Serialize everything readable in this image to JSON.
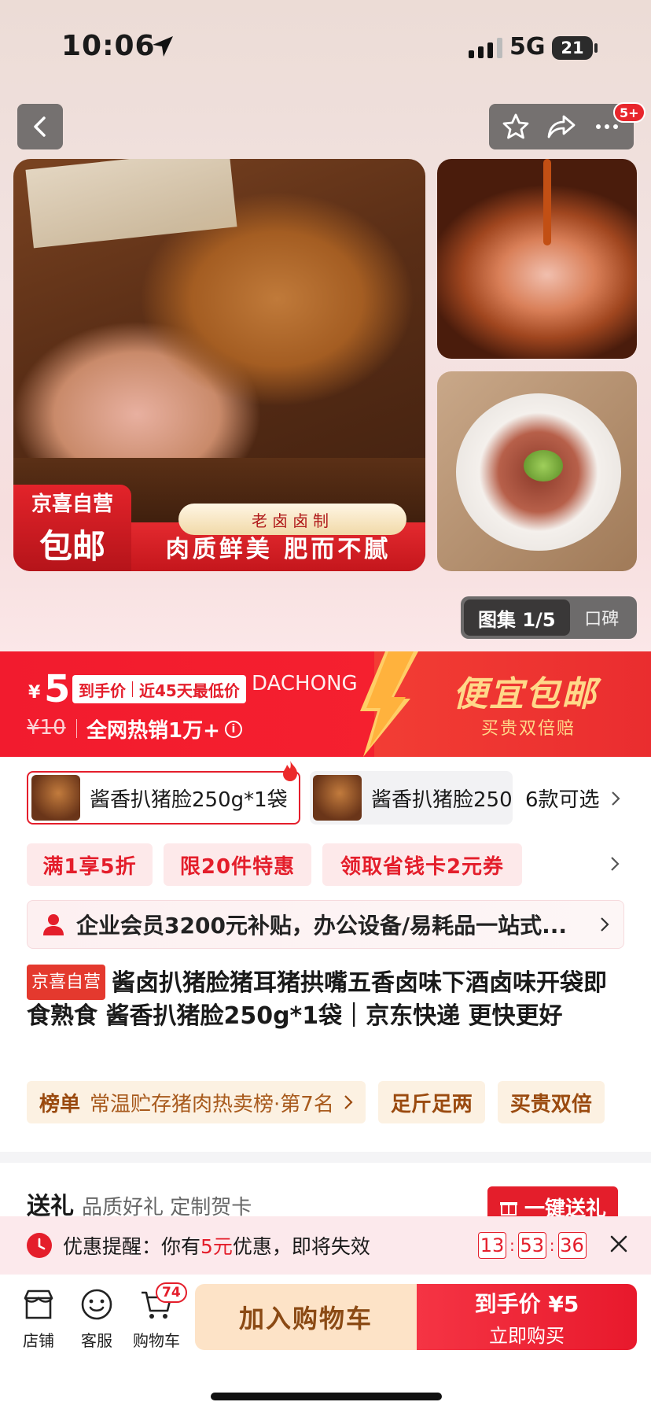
{
  "status_bar": {
    "time": "10:06",
    "network": "5G",
    "battery": "21"
  },
  "nav": {
    "badge": "5+"
  },
  "images": {
    "badge_line1": "京喜自营",
    "badge_line2": "包邮",
    "slogan_tag": "老卤卤制",
    "slogan": "肉质鲜美 肥而不腻"
  },
  "gallery": {
    "active_tab": "图集 1/5",
    "other_tab": "口碑"
  },
  "price": {
    "currency": "¥",
    "amount": "5",
    "tag_label": "到手价",
    "tag_desc": "近45天最低价",
    "watermark": "DACHONG",
    "original": "¥10",
    "sales": "全网热销1万+",
    "info_icon_text": "i",
    "promo_title": "便宜包邮",
    "promo_sub": "买贵双倍赔"
  },
  "variants": {
    "selected": "酱香扒猪脸250g*1袋",
    "other": "酱香扒猪脸250",
    "more": "6款可选"
  },
  "coupons": [
    "满1享5折",
    "限20件特惠",
    "领取省钱卡2元券"
  ],
  "member_banner": "企业会员3200元补贴，办公设备/易耗品一站式...",
  "product": {
    "self_tag": "京喜自营",
    "title": "酱卤扒猪脸猪耳猪拱嘴五香卤味下酒卤味开袋即食熟食 酱香扒猪脸250g*1袋｜京东快递 更快更好"
  },
  "rank": {
    "label": "榜单",
    "value": "常温贮存猪肉热卖榜·第7名",
    "chips": [
      "足斤足两",
      "买贵双倍"
    ]
  },
  "gift": {
    "title": "送礼",
    "subtitle": "品质好礼 定制贺卡",
    "button": "一键送礼"
  },
  "reminder": {
    "prefix": "优惠提醒：你有",
    "highlight": "5元",
    "suffix": "优惠，即将失效",
    "hh": "13",
    "mm": "53",
    "ss": "36"
  },
  "bottom": {
    "store": "店铺",
    "service": "客服",
    "cart": "购物车",
    "cart_count": "74",
    "add_cart": "加入购物车",
    "buy_price": "到手价 ¥5",
    "buy_now": "立即购买"
  },
  "colors": {
    "accent": "#e41e2b",
    "gold": "#ffd889",
    "cart_btn": "#fde3c7"
  }
}
